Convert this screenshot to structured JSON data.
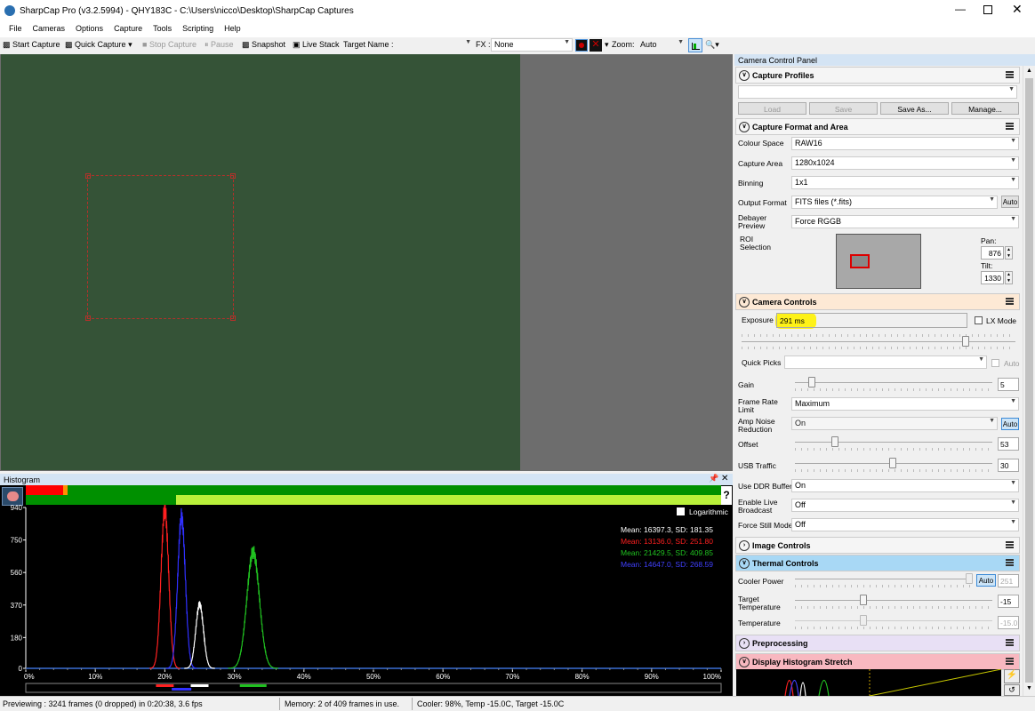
{
  "window": {
    "title": "SharpCap Pro (v3.2.5994) - QHY183C - C:\\Users\\nicco\\Desktop\\SharpCap Captures"
  },
  "menu": [
    "File",
    "Cameras",
    "Options",
    "Capture",
    "Tools",
    "Scripting",
    "Help"
  ],
  "toolbar": {
    "start_capture": "Start Capture",
    "quick_capture": "Quick Capture",
    "stop_capture": "Stop Capture",
    "pause": "Pause",
    "snapshot": "Snapshot",
    "live_stack": "Live Stack",
    "target_name_label": "Target Name :",
    "target_name_value": "",
    "fx_label": "FX :",
    "fx_value": "None",
    "zoom_label": "Zoom:",
    "zoom_value": "Auto"
  },
  "histogram": {
    "title": "Histogram",
    "logarithmic_label": "Logarithmic",
    "logarithmic_checked": false,
    "y_ticks": [
      "940",
      "750",
      "560",
      "370",
      "180",
      "0"
    ],
    "x_ticks": [
      "0%",
      "10%",
      "20%",
      "30%",
      "40%",
      "50%",
      "60%",
      "70%",
      "80%",
      "90%",
      "100%"
    ],
    "stats": [
      {
        "text": "Mean: 16397.3, SD: 181.35",
        "color": "#ffffff"
      },
      {
        "text": "Mean: 13136.0, SD: 251.80",
        "color": "#ff2020"
      },
      {
        "text": "Mean: 21429.5, SD: 409.85",
        "color": "#20c020"
      },
      {
        "text": "Mean: 14647.0, SD: 268.59",
        "color": "#4040ff"
      }
    ],
    "help_label": "?"
  },
  "chart_data": {
    "type": "line",
    "x_unit": "%",
    "ylim": [
      0,
      940
    ],
    "xlim": [
      0,
      100
    ],
    "series": [
      {
        "color": "#ff2020",
        "peak_x": 20.0,
        "peak_y": 925,
        "width": 0.55
      },
      {
        "color": "#3030ff",
        "peak_x": 22.4,
        "peak_y": 885,
        "width": 0.55
      },
      {
        "color": "#ffffff",
        "peak_x": 25.0,
        "peak_y": 375,
        "width": 0.55
      },
      {
        "color": "#20c020",
        "peak_x": 32.7,
        "peak_y": 680,
        "width": 0.9
      }
    ]
  },
  "status": {
    "previewing": "Previewing : 3241 frames (0 dropped) in 0:20:38, 3.6 fps",
    "memory": "Memory: 2 of 409 frames in use.",
    "cooler": "Cooler: 98%, Temp -15.0C, Target -15.0C"
  },
  "panel": {
    "title": "Camera Control Panel",
    "capture_profiles": {
      "title": "Capture Profiles",
      "value": "",
      "load": "Load",
      "save": "Save",
      "save_as": "Save As...",
      "manage": "Manage..."
    },
    "capture_format": {
      "title": "Capture Format and Area",
      "colour_space_label": "Colour Space",
      "colour_space": "RAW16",
      "capture_area_label": "Capture Area",
      "capture_area": "1280x1024",
      "binning_label": "Binning",
      "binning": "1x1",
      "output_format_label": "Output Format",
      "output_format": "FITS files (*.fits)",
      "auto_label": "Auto",
      "debayer_label": "Debayer Preview",
      "debayer": "Force RGGB",
      "roi_label": "ROI Selection",
      "pan_label": "Pan:",
      "pan": "876",
      "tilt_label": "Tilt:",
      "tilt": "1330"
    },
    "camera_controls": {
      "title": "Camera Controls",
      "exposure_label": "Exposure",
      "exposure": "291 ms",
      "lx_mode": "LX Mode",
      "quick_picks_label": "Quick Picks",
      "quick_picks_auto": "Auto",
      "gain_label": "Gain",
      "gain": "5",
      "frame_rate_label": "Frame Rate Limit",
      "frame_rate": "Maximum",
      "amp_noise_label": "Amp Noise Reduction",
      "amp_noise": "On",
      "amp_auto": "Auto",
      "offset_label": "Offset",
      "offset": "53",
      "usb_label": "USB Traffic",
      "usb": "30",
      "ddr_label": "Use DDR Buffer",
      "ddr": "On",
      "broadcast_label": "Enable Live Broadcast",
      "broadcast": "Off",
      "still_label": "Force Still Mode",
      "still": "Off"
    },
    "image_controls": {
      "title": "Image Controls"
    },
    "thermal": {
      "title": "Thermal Controls",
      "cooler_label": "Cooler Power",
      "cooler_auto": "Auto",
      "cooler_value": "251",
      "target_label": "Target Temperature",
      "target_value": "-15",
      "temp_label": "Temperature",
      "temp_value": "-15.0"
    },
    "preprocessing": {
      "title": "Preprocessing"
    },
    "display_stretch": {
      "title": "Display Histogram Stretch"
    }
  }
}
